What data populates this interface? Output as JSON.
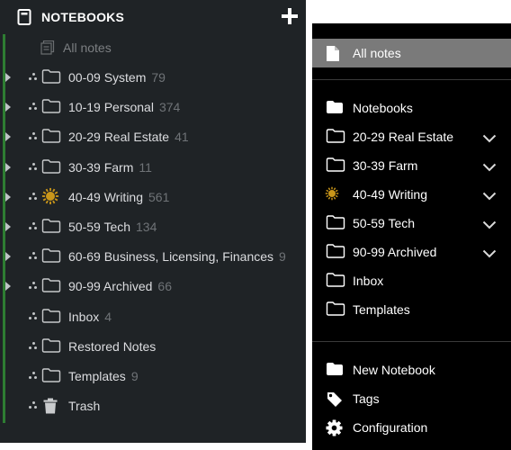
{
  "left_panel": {
    "title": "NOTEBOOKS",
    "all_notes_label": "All notes",
    "notebooks": [
      {
        "name": "00-09 System",
        "count": "79",
        "icon": "folder-outline-icon",
        "expandable": true
      },
      {
        "name": "10-19 Personal",
        "count": "374",
        "icon": "folder-outline-icon",
        "expandable": true
      },
      {
        "name": "20-29 Real Estate",
        "count": "41",
        "icon": "folder-outline-icon",
        "expandable": true
      },
      {
        "name": "30-39 Farm",
        "count": "11",
        "icon": "folder-outline-icon",
        "expandable": true
      },
      {
        "name": "40-49 Writing",
        "count": "561",
        "icon": "sun-icon",
        "expandable": true
      },
      {
        "name": "50-59 Tech",
        "count": "134",
        "icon": "folder-outline-icon",
        "expandable": true
      },
      {
        "name": "60-69 Business, Licensing, Finances",
        "count": "9",
        "icon": "folder-outline-icon",
        "expandable": true
      },
      {
        "name": "90-99 Archived",
        "count": "66",
        "icon": "folder-outline-icon",
        "expandable": true
      },
      {
        "name": "Inbox",
        "count": "4",
        "icon": "folder-outline-icon",
        "expandable": false
      },
      {
        "name": "Restored Notes",
        "count": "",
        "icon": "folder-outline-icon",
        "expandable": false
      },
      {
        "name": "Templates",
        "count": "9",
        "icon": "folder-outline-icon",
        "expandable": false
      },
      {
        "name": "Trash",
        "count": "",
        "icon": "trash-icon",
        "expandable": false
      }
    ]
  },
  "right_panel": {
    "all_notes_label": "All notes",
    "notebooks_label": "Notebooks",
    "notebooks": [
      {
        "name": "20-29 Real Estate",
        "icon": "folder-outline-icon",
        "chevron": true
      },
      {
        "name": "30-39 Farm",
        "icon": "folder-outline-icon",
        "chevron": true
      },
      {
        "name": "40-49 Writing",
        "icon": "sun-icon",
        "chevron": true
      },
      {
        "name": "50-59 Tech",
        "icon": "folder-outline-icon",
        "chevron": true
      },
      {
        "name": "90-99 Archived",
        "icon": "folder-outline-icon",
        "chevron": true
      },
      {
        "name": "Inbox",
        "icon": "folder-outline-icon",
        "chevron": false
      },
      {
        "name": "Templates",
        "icon": "folder-outline-icon",
        "chevron": false
      }
    ],
    "new_notebook_label": "New Notebook",
    "tags_label": "Tags",
    "configuration_label": "Configuration"
  },
  "colors": {
    "left_bg": "#1f2326",
    "left_accent": "#2e7d32",
    "right_bg": "#000000",
    "selected_bg": "#7a7a7a",
    "sun": "#c9961a"
  }
}
